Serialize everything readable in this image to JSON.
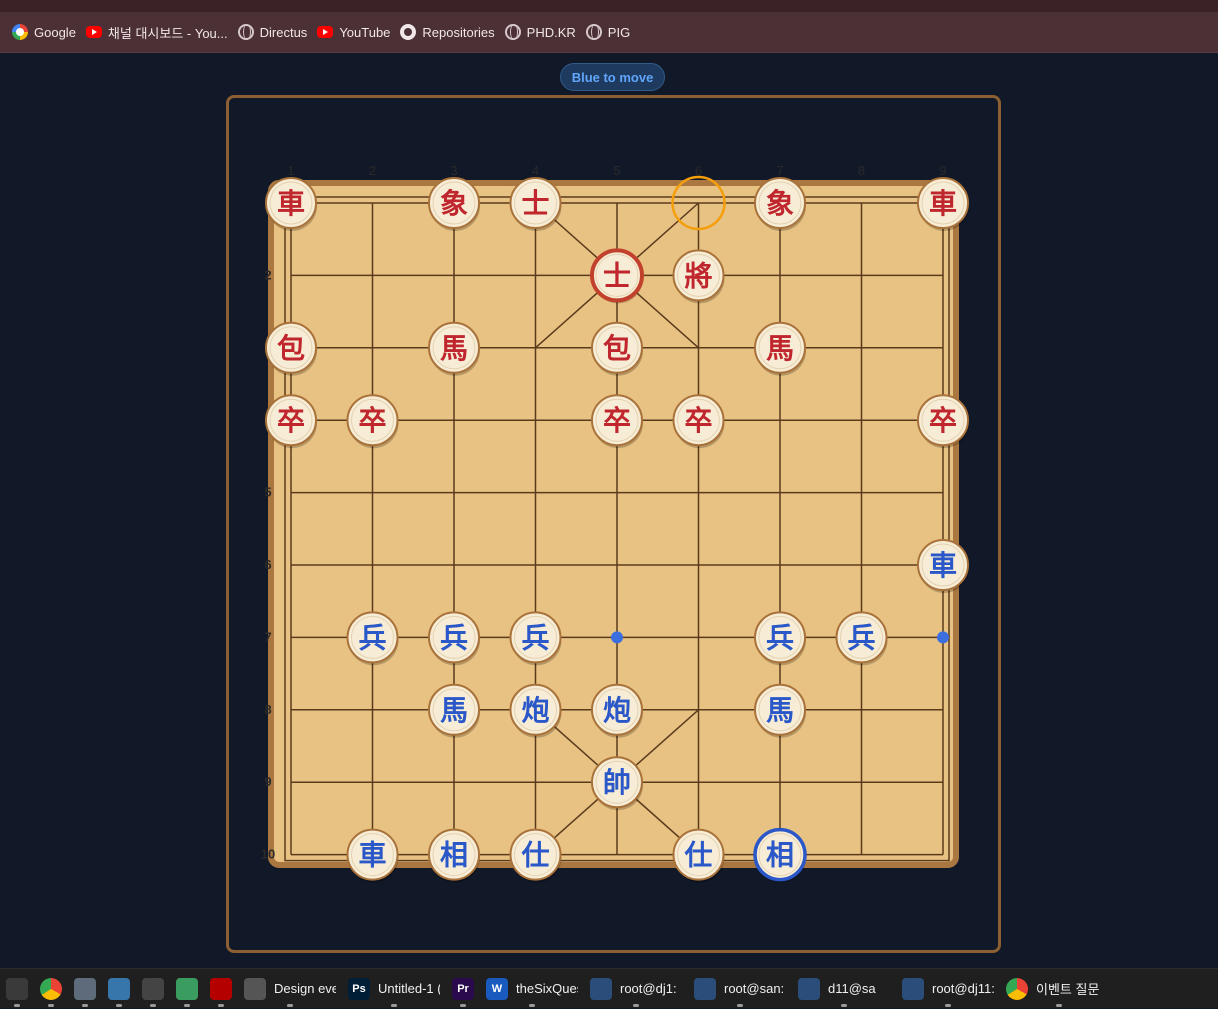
{
  "bookmarks": [
    {
      "label": "Google",
      "icon": "google-icon"
    },
    {
      "label": "채널 대시보드 - You...",
      "icon": "youtube-icon"
    },
    {
      "label": "Directus",
      "icon": "globe-icon"
    },
    {
      "label": "YouTube",
      "icon": "youtube-icon"
    },
    {
      "label": "Repositories",
      "icon": "github-icon"
    },
    {
      "label": "PHD.KR",
      "icon": "globe-icon"
    },
    {
      "label": "PIG",
      "icon": "globe-icon"
    }
  ],
  "game": {
    "status": "Blue to move",
    "file_labels": [
      "1",
      "2",
      "3",
      "4",
      "5",
      "6",
      "7",
      "8",
      "9"
    ],
    "rank_labels": [
      "2",
      "3",
      "4",
      "5",
      "6",
      "7",
      "8",
      "9",
      "10"
    ],
    "red_pieces": [
      {
        "char": "車",
        "file": 1,
        "rank": 1
      },
      {
        "char": "象",
        "file": 3,
        "rank": 1
      },
      {
        "char": "士",
        "file": 4,
        "rank": 1
      },
      {
        "char": "象",
        "file": 7,
        "rank": 1
      },
      {
        "char": "車",
        "file": 9,
        "rank": 1
      },
      {
        "char": "士",
        "file": 5,
        "rank": 2,
        "highlight": "last-move"
      },
      {
        "char": "將",
        "file": 6,
        "rank": 2
      },
      {
        "char": "包",
        "file": 1,
        "rank": 3
      },
      {
        "char": "馬",
        "file": 3,
        "rank": 3
      },
      {
        "char": "包",
        "file": 5,
        "rank": 3
      },
      {
        "char": "馬",
        "file": 7,
        "rank": 3
      },
      {
        "char": "卒",
        "file": 1,
        "rank": 4
      },
      {
        "char": "卒",
        "file": 2,
        "rank": 4
      },
      {
        "char": "卒",
        "file": 5,
        "rank": 4
      },
      {
        "char": "卒",
        "file": 6,
        "rank": 4
      },
      {
        "char": "卒",
        "file": 9,
        "rank": 4
      }
    ],
    "blue_pieces": [
      {
        "char": "車",
        "file": 9,
        "rank": 6
      },
      {
        "char": "兵",
        "file": 2,
        "rank": 7
      },
      {
        "char": "兵",
        "file": 3,
        "rank": 7
      },
      {
        "char": "兵",
        "file": 4,
        "rank": 7
      },
      {
        "char": "兵",
        "file": 7,
        "rank": 7
      },
      {
        "char": "兵",
        "file": 8,
        "rank": 7
      },
      {
        "char": "馬",
        "file": 3,
        "rank": 8
      },
      {
        "char": "炮",
        "file": 4,
        "rank": 8
      },
      {
        "char": "炮",
        "file": 5,
        "rank": 8
      },
      {
        "char": "馬",
        "file": 7,
        "rank": 8
      },
      {
        "char": "帥",
        "file": 5,
        "rank": 9
      },
      {
        "char": "車",
        "file": 2,
        "rank": 10
      },
      {
        "char": "相",
        "file": 3,
        "rank": 10
      },
      {
        "char": "仕",
        "file": 4,
        "rank": 10
      },
      {
        "char": "仕",
        "file": 6,
        "rank": 10
      },
      {
        "char": "相",
        "file": 7,
        "rank": 10,
        "highlight": "selected"
      }
    ],
    "last_move_from": {
      "file": 6,
      "rank": 1
    },
    "move_hints": [
      {
        "file": 5,
        "rank": 7
      },
      {
        "file": 9,
        "rank": 7
      }
    ],
    "colors": {
      "board": "#e8c282",
      "board_border": "#a9773f",
      "line": "#5a3a1c",
      "red_piece_text": "#c0262d",
      "blue_piece_text": "#2a58c8",
      "piece_fill": "#f7ecd6",
      "piece_rim": "#a8723a",
      "last_move_ring": "#f59e0b",
      "last_move_piece_ring": "#c2412d",
      "selected_ring": "#2a58c8",
      "hint_dot": "#3b6fe0"
    }
  },
  "taskbar": [
    {
      "label": "",
      "icon": "obs-icon",
      "color": "#3a3a3a"
    },
    {
      "label": "",
      "icon": "chrome-icon",
      "color": "#1a73e8"
    },
    {
      "label": "",
      "icon": "calculator-icon",
      "color": "#5d6b7a"
    },
    {
      "label": "",
      "icon": "python-icon",
      "color": "#3776ab"
    },
    {
      "label": "",
      "icon": "terminal-icon",
      "color": "#444444"
    },
    {
      "label": "",
      "icon": "atom-icon",
      "color": "#3b9c5f"
    },
    {
      "label": "",
      "icon": "filezilla-icon",
      "color": "#b50000"
    },
    {
      "label": "Design eve",
      "icon": "app-icon",
      "color": "#555555"
    },
    {
      "label": "Untitled-1 (",
      "icon": "photoshop-icon",
      "color": "#001e36",
      "glyph": "Ps"
    },
    {
      "label": "",
      "icon": "premiere-icon",
      "color": "#2a0a4d",
      "glyph": "Pr"
    },
    {
      "label": "theSixQues",
      "icon": "word-icon",
      "color": "#185abd",
      "glyph": "W"
    },
    {
      "label": "root@dj1:",
      "icon": "remote-desktop-icon",
      "color": "#2a4d7a"
    },
    {
      "label": "root@san:",
      "icon": "remote-desktop-icon",
      "color": "#2a4d7a"
    },
    {
      "label": "d11@sa",
      "icon": "remote-desktop-icon",
      "color": "#2a4d7a"
    },
    {
      "label": "root@dj11:",
      "icon": "remote-desktop-icon",
      "color": "#2a4d7a"
    },
    {
      "label": "이벤트 질문",
      "icon": "chrome-icon",
      "color": "#1a73e8"
    }
  ]
}
